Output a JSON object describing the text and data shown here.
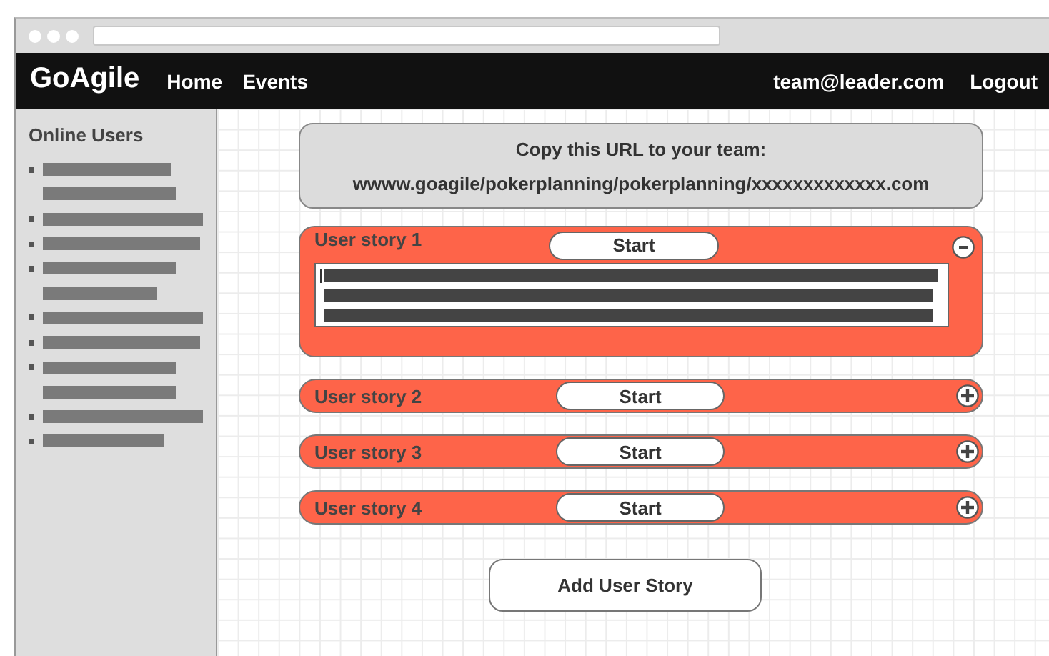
{
  "app": {
    "logo": "GoAgile",
    "nav": [
      "Home",
      "Events"
    ],
    "user": "team@leader.com",
    "logout": "Logout"
  },
  "sidebar": {
    "title": "Online Users",
    "users": [
      {
        "kind": "wrapped"
      },
      {
        "kind": "single"
      },
      {
        "kind": "single"
      },
      {
        "kind": "wrapped"
      },
      {
        "kind": "single"
      },
      {
        "kind": "single"
      },
      {
        "kind": "wrapped"
      },
      {
        "kind": "single"
      },
      {
        "kind": "short"
      }
    ]
  },
  "share": {
    "heading": "Copy this URL to your team:",
    "url": "wwww.goagile/pokerplanning/pokerplanning/xxxxxxxxxxxxx.com"
  },
  "stories": [
    {
      "title": "User story 1",
      "button": "Start",
      "expanded": true
    },
    {
      "title": "User story 2",
      "button": "Start",
      "expanded": false
    },
    {
      "title": "User story 3",
      "button": "Start",
      "expanded": false
    },
    {
      "title": "User story 4",
      "button": "Start",
      "expanded": false
    }
  ],
  "add_button": "Add User Story"
}
